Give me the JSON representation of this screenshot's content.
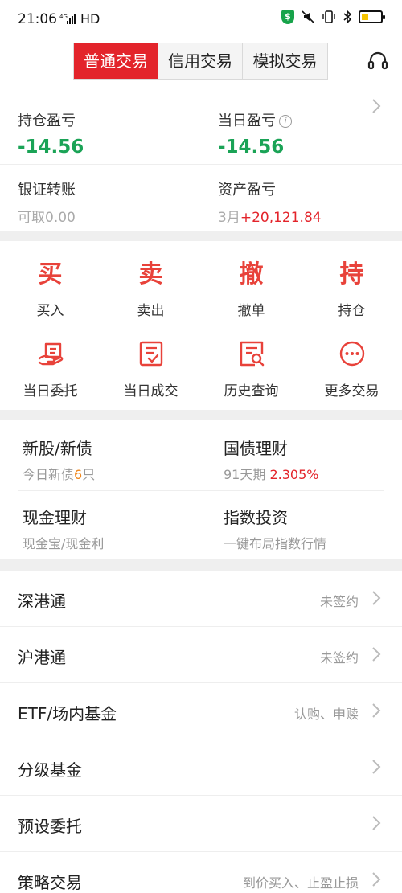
{
  "status_bar": {
    "time": "21:06",
    "network": "HD",
    "signal": "4G"
  },
  "tabs": [
    {
      "label": "普通交易"
    },
    {
      "label": "信用交易"
    },
    {
      "label": "模拟交易"
    }
  ],
  "account": {
    "holding_pl": {
      "label": "持仓盈亏",
      "value": "-14.56"
    },
    "daily_pl": {
      "label": "当日盈亏",
      "value": "-14.56",
      "info": "i"
    },
    "transfer": {
      "label": "银证转账",
      "sub": "可取0.00"
    },
    "asset_pl": {
      "label": "资产盈亏",
      "sub_prefix": "3月",
      "sub_value": "+20,121.84"
    }
  },
  "trade": {
    "buy": {
      "char": "买",
      "label": "买入"
    },
    "sell": {
      "char": "卖",
      "label": "卖出"
    },
    "cancel": {
      "char": "撤",
      "label": "撤单"
    },
    "hold": {
      "char": "持",
      "label": "持仓"
    },
    "today_orders": {
      "label": "当日委托",
      "icon": "hand-order-icon"
    },
    "today_deals": {
      "label": "当日成交",
      "icon": "doc-check-icon"
    },
    "history": {
      "label": "历史查询",
      "icon": "doc-search-icon"
    },
    "more": {
      "label": "更多交易",
      "icon": "more-dots-icon"
    }
  },
  "products": {
    "ipo": {
      "title": "新股/新债",
      "sub_prefix": "今日新债",
      "sub_count": "6",
      "sub_suffix": "只"
    },
    "bond": {
      "title": "国债理财",
      "sub_prefix": "91天期 ",
      "sub_rate": "2.305%"
    },
    "cash": {
      "title": "现金理财",
      "sub": "现金宝/现金利"
    },
    "index": {
      "title": "指数投资",
      "sub": "一键布局指数行情"
    }
  },
  "list": [
    {
      "title": "深港通",
      "right": "未签约"
    },
    {
      "title": "沪港通",
      "right": "未签约"
    },
    {
      "title": "ETF/场内基金",
      "right": "认购、申赎"
    },
    {
      "title": "分级基金",
      "right": ""
    },
    {
      "title": "预设委托",
      "right": ""
    },
    {
      "title": "策略交易",
      "right": "到价买入、止盈止损"
    }
  ],
  "colors": {
    "accent": "#e3242b",
    "loss": "#1aa356",
    "trade_icon": "#e8423a",
    "orange": "#f0861a"
  }
}
